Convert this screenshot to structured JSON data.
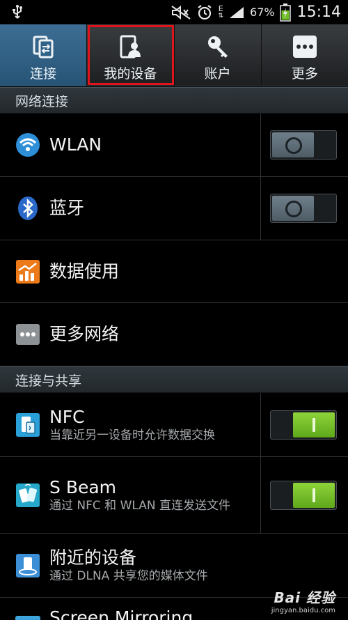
{
  "status_bar": {
    "icons_left": [
      "usb-icon"
    ],
    "icons_right": [
      "mute-icon",
      "alarm-icon",
      "edge-data-icon",
      "signal-icon"
    ],
    "network_type": "E",
    "battery_percent": "67%",
    "battery_charging": true,
    "time": "15:14"
  },
  "tabs": [
    {
      "label": "连接",
      "icon": "connection-icon",
      "active": true
    },
    {
      "label": "我的设备",
      "icon": "my-device-icon",
      "active": false,
      "highlighted": true
    },
    {
      "label": "账户",
      "icon": "account-key-icon",
      "active": false
    },
    {
      "label": "更多",
      "icon": "more-dots-icon",
      "active": false
    }
  ],
  "sections": {
    "network": {
      "header": "网络连接"
    },
    "sharing": {
      "header": "连接与共享"
    }
  },
  "rows": {
    "wlan": {
      "title": "WLAN",
      "icon": "wifi-icon",
      "toggle": "off"
    },
    "bluetooth": {
      "title": "蓝牙",
      "icon": "bluetooth-icon",
      "toggle": "off"
    },
    "data_usage": {
      "title": "数据使用",
      "icon": "data-usage-icon"
    },
    "more_networks": {
      "title": "更多网络",
      "icon": "more-networks-icon"
    },
    "nfc": {
      "title": "NFC",
      "subtitle": "当靠近另一设备时允许数据交换",
      "icon": "nfc-icon",
      "toggle": "on"
    },
    "s_beam": {
      "title": "S Beam",
      "subtitle": "通过 NFC 和 WLAN 直连发送文件",
      "icon": "s-beam-icon",
      "toggle": "on"
    },
    "nearby_devices": {
      "title": "附近的设备",
      "subtitle": "通过 DLNA 共享您的媒体文件",
      "icon": "nearby-devices-icon"
    },
    "screen_mirroring": {
      "title": "Screen Mirroring",
      "icon": "screen-mirroring-icon"
    }
  },
  "colors": {
    "active_tab": "#2f6287",
    "highlight_border": "#e0141a",
    "toggle_on": "#6fbe25",
    "toggle_off": "#5d6c76"
  },
  "watermark": {
    "logo": "Bai 经验",
    "url": "jingyan.baidu.com"
  }
}
